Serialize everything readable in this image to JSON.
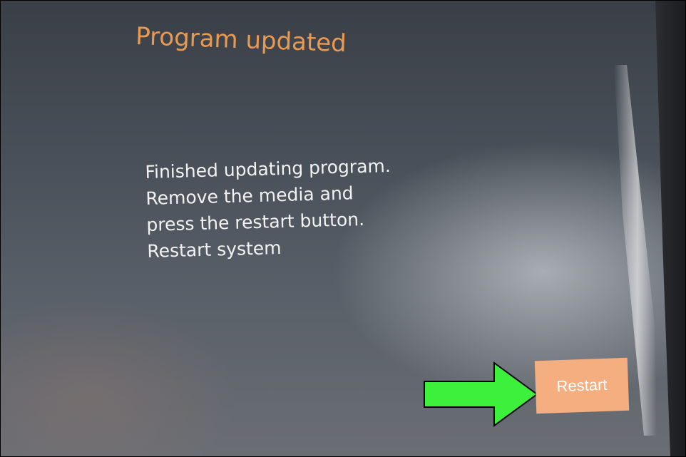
{
  "screen": {
    "title": "Program updated",
    "message_lines": [
      "Finished updating program.",
      "Remove the media and",
      "press the restart button.",
      "Restart system"
    ],
    "restart_label": "Restart"
  },
  "colors": {
    "title": "#e99a52",
    "message_text": "#f2f2f2",
    "restart_button_bg": "#f4ae80",
    "annotation_arrow": "#3cf03c"
  },
  "annotation": {
    "icon": "right-arrow-icon"
  }
}
